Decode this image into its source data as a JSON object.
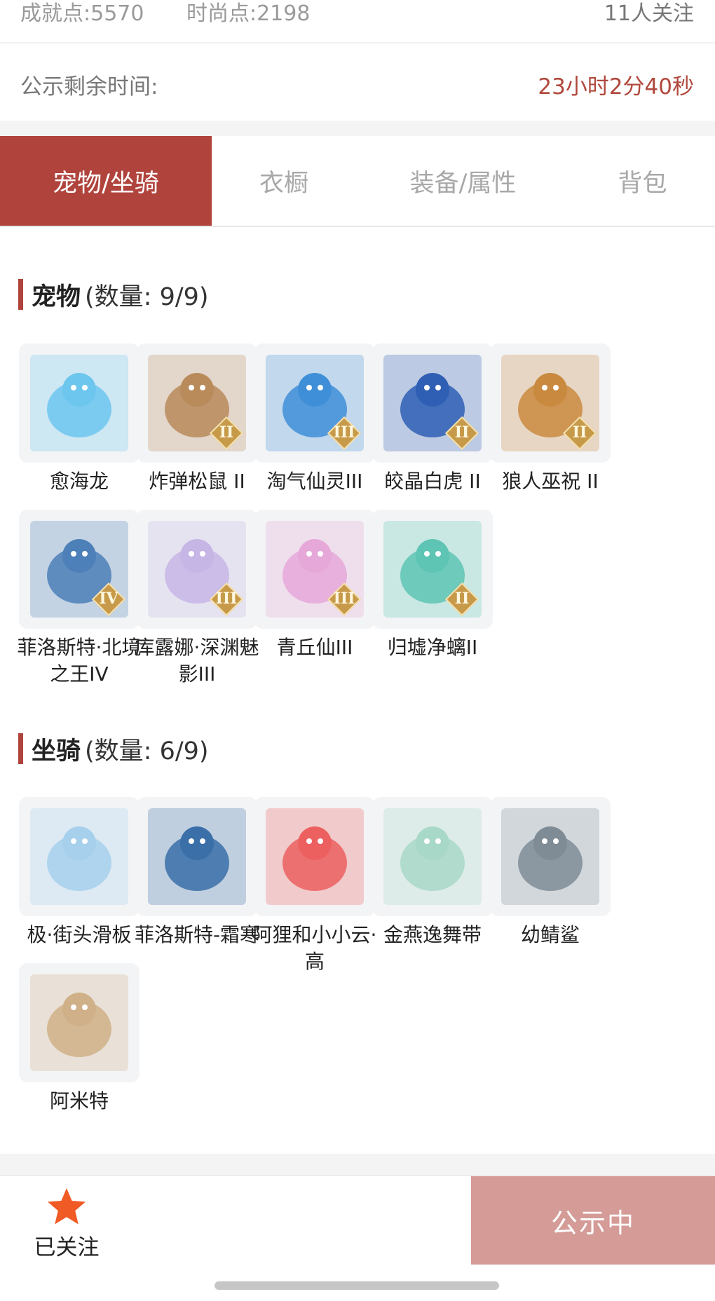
{
  "stats": {
    "achievement": "成就点:5570",
    "fashion": "时尚点:2198",
    "followers": "11人关注"
  },
  "countdown": {
    "label": "公示剩余时间:",
    "value": "23小时2分40秒"
  },
  "tabs": [
    {
      "label": "宠物/坐骑",
      "active": true
    },
    {
      "label": "衣橱",
      "active": false
    },
    {
      "label": "装备/属性",
      "active": false
    },
    {
      "label": "背包",
      "active": false
    }
  ],
  "pets": {
    "title": "宠物",
    "count": "(数量: 9/9)",
    "items": [
      {
        "name": "愈海龙",
        "rank": "",
        "icon": "sea-dragon-icon",
        "color": "#6cc6ee"
      },
      {
        "name": "炸弹松鼠 II",
        "rank": "II",
        "icon": "squirrel-icon",
        "color": "#b98a5a"
      },
      {
        "name": "淘气仙灵III",
        "rank": "III",
        "icon": "blue-pup-icon",
        "color": "#3f8fd8"
      },
      {
        "name": "皎晶白虎 II",
        "rank": "II",
        "icon": "white-tiger-icon",
        "color": "#2f5fb5"
      },
      {
        "name": "狼人巫祝 II",
        "rank": "II",
        "icon": "werewolf-icon",
        "color": "#c9893f"
      },
      {
        "name": "菲洛斯特·北境之王IV",
        "rank": "IV",
        "icon": "frost-king-icon",
        "color": "#4d7fb8"
      },
      {
        "name": "库露娜·深渊魅影III",
        "rank": "III",
        "icon": "white-haired-girl-icon",
        "color": "#c6b6e6"
      },
      {
        "name": "青丘仙III",
        "rank": "III",
        "icon": "fox-fairy-icon",
        "color": "#e6a8d8"
      },
      {
        "name": "归墟净螭II",
        "rank": "II",
        "icon": "jade-dragon-icon",
        "color": "#5ec4b4"
      }
    ]
  },
  "mounts": {
    "title": "坐骑",
    "count": "(数量: 6/9)",
    "items": [
      {
        "name": "极·街头滑板",
        "rank": "",
        "icon": "skateboard-icon",
        "color": "#a6d0ec"
      },
      {
        "name": "菲洛斯特-霜寒",
        "rank": "",
        "icon": "frost-rider-icon",
        "color": "#3a6fa8"
      },
      {
        "name": "阿狸和小小云·高",
        "rank": "",
        "icon": "fox-cloud-icon",
        "color": "#ec6060"
      },
      {
        "name": "金燕逸舞带",
        "rank": "",
        "icon": "golden-ribbon-icon",
        "color": "#a8d8c8"
      },
      {
        "name": "幼鲭鲨",
        "rank": "",
        "icon": "shark-icon",
        "color": "#7f8c96"
      },
      {
        "name": "阿米特",
        "rank": "",
        "icon": "crocodile-icon",
        "color": "#d0b088"
      }
    ]
  },
  "footer": {
    "follow_label": "已关注",
    "status_label": "公示中"
  },
  "colors": {
    "accent": "#b0443d",
    "countdown": "#b0483c",
    "status_button": "#d49b97",
    "star": "#f05a24"
  }
}
